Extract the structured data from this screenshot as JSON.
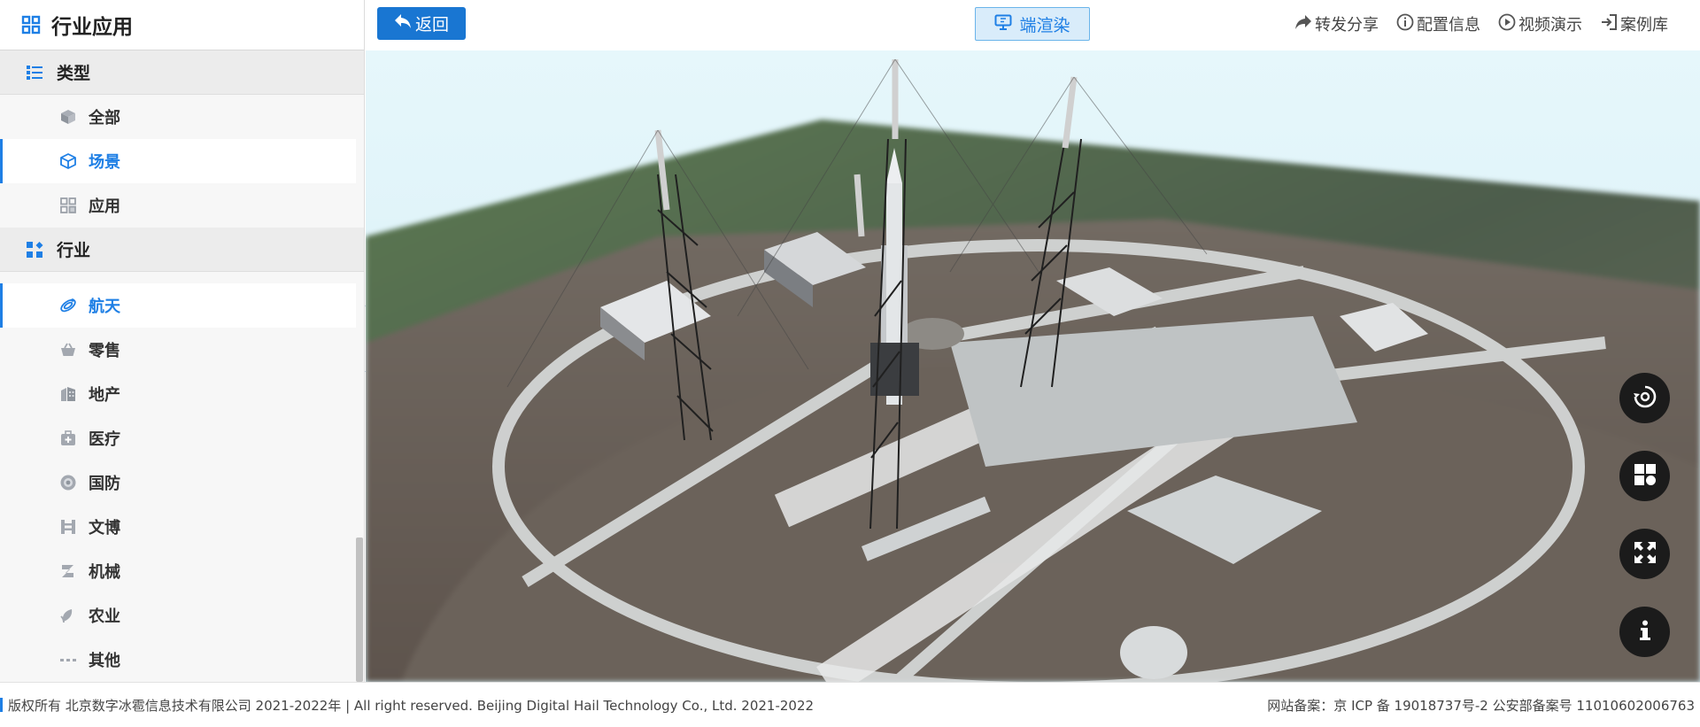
{
  "sidebar": {
    "title": "行业应用",
    "sections": [
      {
        "label": "类型",
        "items": [
          {
            "label": "全部",
            "icon": "cube-layers-icon",
            "active": false
          },
          {
            "label": "场景",
            "icon": "cube-icon",
            "active": true
          },
          {
            "label": "应用",
            "icon": "grid-icon",
            "active": false
          }
        ]
      },
      {
        "label": "行业",
        "items": [
          {
            "label": "航天",
            "icon": "rocket-icon",
            "active": true
          },
          {
            "label": "零售",
            "icon": "basket-icon",
            "active": false
          },
          {
            "label": "地产",
            "icon": "building-icon",
            "active": false
          },
          {
            "label": "医疗",
            "icon": "medical-kit-icon",
            "active": false
          },
          {
            "label": "国防",
            "icon": "shield-target-icon",
            "active": false
          },
          {
            "label": "文博",
            "icon": "museum-icon",
            "active": false
          },
          {
            "label": "机械",
            "icon": "gear-icon",
            "active": false
          },
          {
            "label": "农业",
            "icon": "leaf-icon",
            "active": false
          },
          {
            "label": "其他",
            "icon": "dots-icon",
            "active": false
          }
        ]
      }
    ]
  },
  "topbar": {
    "back_label": "返回",
    "render_label": "端渲染",
    "actions": [
      {
        "label": "转发分享",
        "icon": "share-icon"
      },
      {
        "label": "配置信息",
        "icon": "info-circle-icon"
      },
      {
        "label": "视频演示",
        "icon": "play-circle-icon"
      },
      {
        "label": "案例库",
        "icon": "exit-icon"
      }
    ]
  },
  "floating_buttons": [
    {
      "name": "rotate-view-button",
      "icon": "rotate-icon"
    },
    {
      "name": "layout-button",
      "icon": "layout-icon"
    },
    {
      "name": "fullscreen-button",
      "icon": "expand-icon"
    },
    {
      "name": "info-button",
      "icon": "info-icon"
    }
  ],
  "footer": {
    "copyright": "版权所有 北京数字冰雹信息技术有限公司 2021-2022年 | All right reserved. Beijing Digital Hail Technology Co., Ltd. 2021-2022",
    "icp": "网站备案：京 ICP 备 19018737号-2 公安部备案号 11010602006763"
  },
  "colors": {
    "accent": "#1e7fe5",
    "button_blue": "#1976d2",
    "fab_dark": "#1b1b1b"
  }
}
